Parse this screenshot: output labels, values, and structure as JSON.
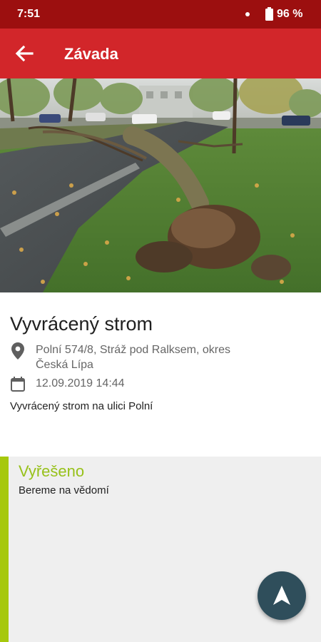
{
  "status_bar": {
    "time": "7:51",
    "battery": "96 %"
  },
  "app_bar": {
    "title": "Závada",
    "back_icon": "arrow-back-icon"
  },
  "issue": {
    "title": "Vyvrácený strom",
    "address": "Polní 574/8, Stráž pod Ralksem, okres Česká Lípa",
    "datetime": "12.09.2019 14:44",
    "description": "Vyvrácený strom na ulici Polní"
  },
  "status": {
    "label": "Vyřešeno",
    "note": "Bereme na vědomí",
    "color": "#a6c80d"
  },
  "fab": {
    "icon": "navigation-arrow-icon"
  },
  "colors": {
    "status_bar": "#9c0f0f",
    "app_bar": "#d2262a",
    "fab": "#2f4e5b"
  }
}
